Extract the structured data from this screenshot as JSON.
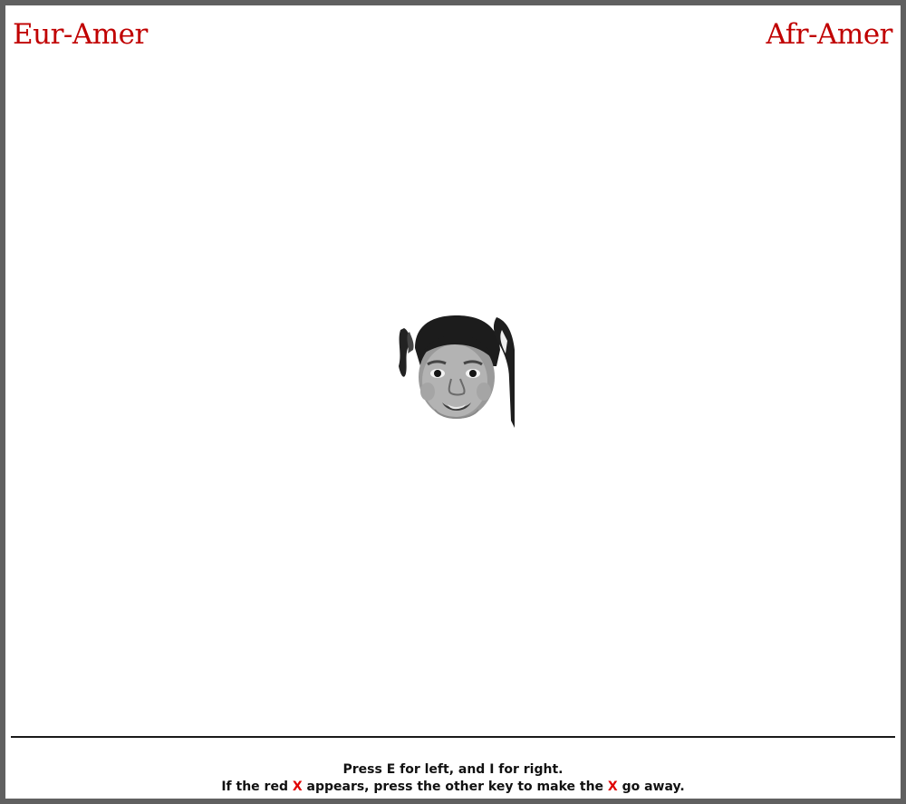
{
  "labels": {
    "left": "Eur-Amer",
    "right": "Afr-Amer",
    "color": "#c00000"
  },
  "stimulus": {
    "type": "face-photo",
    "icon": "child-face-image"
  },
  "instructions": {
    "line1": "Press E for left, and I for right.",
    "line2_before": "If the red ",
    "x_mark": "X",
    "line2_middle": " appears, press the other key to make the ",
    "line2_after": " go away.",
    "x_color": "#e00000"
  }
}
